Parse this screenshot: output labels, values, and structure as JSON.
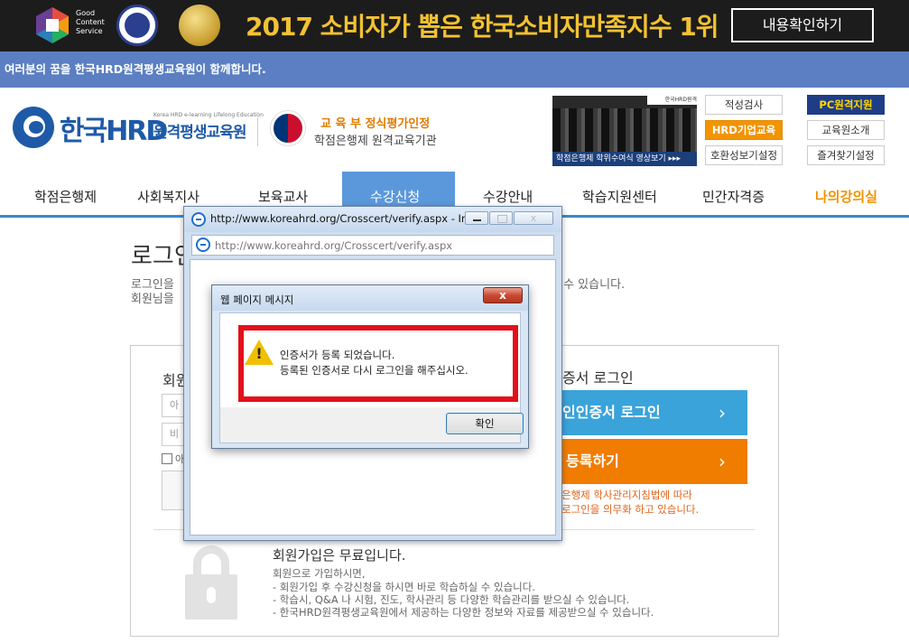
{
  "banner": {
    "gc_lines": [
      "Good",
      "Content",
      "Service"
    ],
    "title": "2017 소비자가 뽑은 한국소비자만족지수 1위",
    "button": "내용확인하기"
  },
  "slogan": "여러분의 꿈을 한국HRD원격평생교육원이 함께합니다.",
  "header": {
    "logo_main": "한국HRD",
    "logo_sub": "Korea HRD e-learning Lifelong Education",
    "logo_name": "원격평생교육원",
    "moe_line1": "교 육 부   정식평가인정",
    "moe_line2": "학점은행제 원격교육기관",
    "video_caption": "학점은행제 학위수여식 영상보기 ▸▸▸",
    "video_brand": "한국HRD원격",
    "buttons": [
      "적성검사",
      "PC원격지원",
      "HRD기업교육",
      "교육원소개",
      "호환성보기설정",
      "즐겨찾기설정"
    ]
  },
  "nav": {
    "items": [
      "학점은행제",
      "사회복지사",
      "보육교사",
      "수강신청",
      "수강안내",
      "학습지원센터",
      "민간자격증",
      "나의강의실"
    ]
  },
  "page": {
    "title": "로그인",
    "desc1": "로그인을",
    "desc2": "회원님을",
    "desc_right": "실 수 있습니다.",
    "login_heading": "회원",
    "id_placeholder": "아",
    "pw_placeholder": "비",
    "remember_label": "아",
    "cert_heading": "증서 로그인",
    "cert_login_btn": "인인증서 로그인",
    "cert_register_btn": "등록하기",
    "cert_note1": "은행제 학사관리지침법에 따라",
    "cert_note2": "로그인을 의무화 하고 있습니다.",
    "join_title": "회원가입은 무료입니다.",
    "join_lines": [
      "회원으로 가입하시면,",
      "- 회원가입 후 수강신청을 하시면 바로 학습하실 수 있습니다.",
      "- 학습시, Q&A 나 시험, 진도, 학사관리 등 다양한 학습관리를 받으실 수 있습니다.",
      "- 한국HRD원격평생교육원에서 제공하는 다양한 정보와 자료를 제공받으실 수 있습니다."
    ]
  },
  "ie_window": {
    "title": "http://www.koreahrd.org/Crosscert/verify.aspx - In...",
    "address": "http://www.koreahrd.org/Crosscert/verify.aspx"
  },
  "dialog": {
    "title": "웹 페이지 메시지",
    "close_label": "x",
    "line1": "인증서가 등록 되었습니다.",
    "line2": "등록된 인증서로 다시 로그인을 해주십시오.",
    "ok_label": "확인",
    "warning_mark": "!"
  },
  "colors": {
    "nav_active": "#5b98db",
    "highlight": "#e3101a",
    "cert_login": "#3aa3da",
    "cert_register": "#f07c00"
  }
}
